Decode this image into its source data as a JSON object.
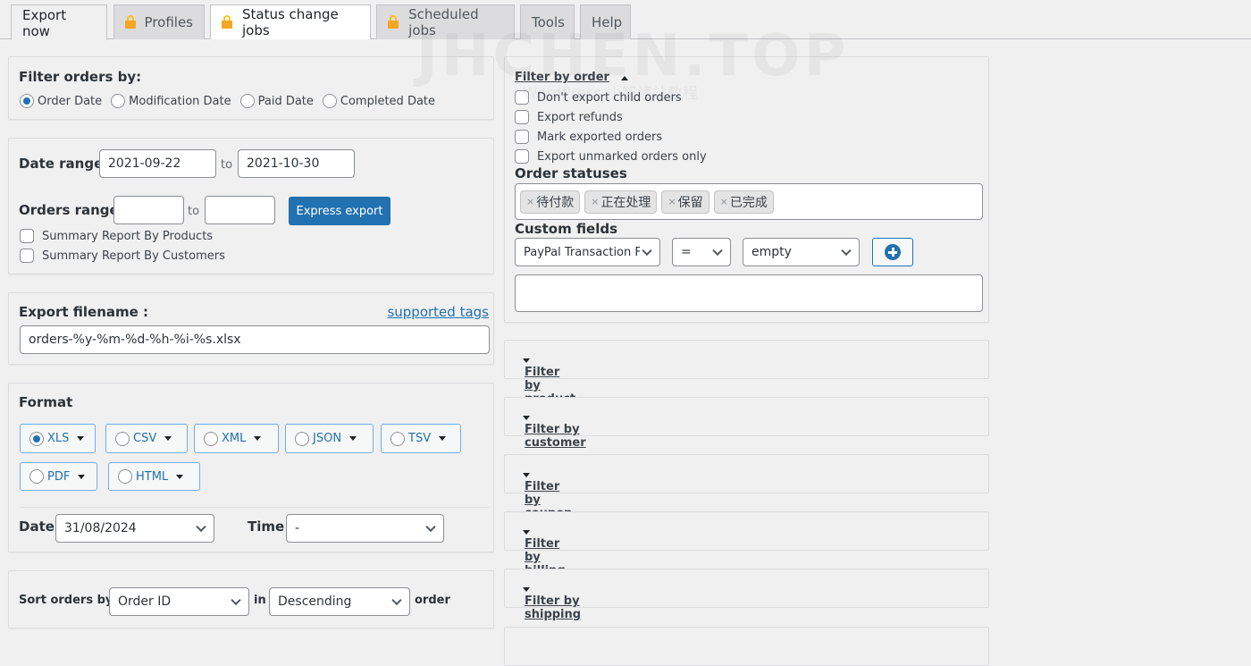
{
  "tabs": [
    {
      "label": "Export now",
      "locked": false,
      "state": "active"
    },
    {
      "label": "Profiles",
      "locked": true,
      "state": "inactive"
    },
    {
      "label": "Status change jobs",
      "locked": true,
      "state": "highlighted"
    },
    {
      "label": "Scheduled jobs",
      "locked": true,
      "state": "inactive"
    },
    {
      "label": "Tools",
      "locked": false,
      "state": "inactive"
    },
    {
      "label": "Help",
      "locked": false,
      "state": "inactive"
    }
  ],
  "watermark": {
    "title": "JHCHEN.TOP",
    "subtitle": "WordPress 小智建站教程"
  },
  "filter_orders_by": {
    "title": "Filter orders by:",
    "options": [
      "Order Date",
      "Modification Date",
      "Paid Date",
      "Completed Date"
    ],
    "selected": "Order Date"
  },
  "ranges": {
    "date_range_label": "Date range",
    "date_from": "2021-09-22",
    "to_label": "to",
    "date_to": "2021-10-30",
    "orders_range_label": "Orders range",
    "orders_from": "",
    "orders_to": "",
    "express_export_label": "Express export",
    "summary_by_products": "Summary Report By Products",
    "summary_by_customers": "Summary Report By Customers"
  },
  "export_filename": {
    "label": "Export filename :",
    "supported_tags_link": "supported tags",
    "value": "orders-%y-%m-%d-%h-%i-%s.xlsx"
  },
  "format": {
    "title": "Format",
    "options": [
      "XLS",
      "CSV",
      "XML",
      "JSON",
      "TSV",
      "PDF",
      "HTML"
    ],
    "selected": "XLS",
    "date_label": "Date",
    "date_value": "31/08/2024",
    "time_label": "Time",
    "time_value": "-"
  },
  "sort": {
    "label": "Sort orders by",
    "field_value": "Order ID",
    "in_label": "in",
    "direction_value": "Descending",
    "order_label": "order"
  },
  "filter_by_order": {
    "title": "Filter by order",
    "checkboxes": [
      "Don't export child orders",
      "Export refunds",
      "Mark exported orders",
      "Export unmarked orders only"
    ],
    "order_statuses_label": "Order statuses",
    "statuses": [
      "待付款",
      "正在处理",
      "保留",
      "已完成"
    ],
    "custom_fields_label": "Custom fields",
    "custom_field_value": "PayPal Transaction Fee",
    "operator_value": "=",
    "condition_value": "empty",
    "custom_fields_text": ""
  },
  "collapsed_filters": [
    "Filter by product",
    "Filter by customer",
    "Filter by coupon",
    "Filter by billing",
    "Filter by shipping"
  ],
  "colors": {
    "accent": "#2271b1",
    "lock": "#f5a623",
    "background": "#f0f0f1"
  }
}
